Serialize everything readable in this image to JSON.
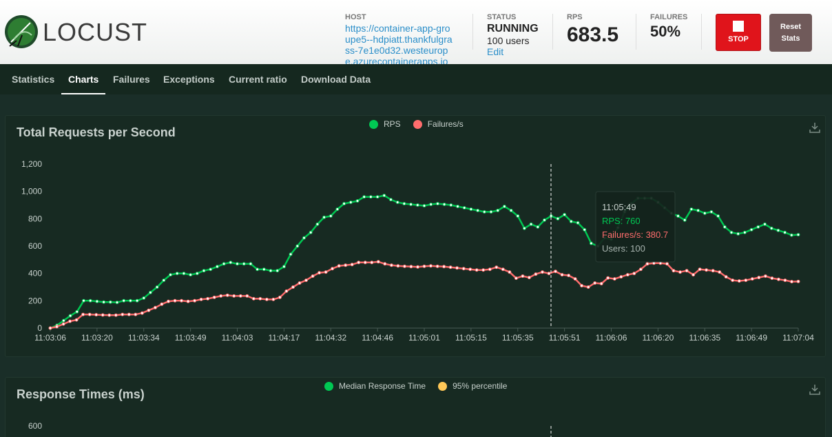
{
  "header": {
    "logo_text": "LOCUST",
    "host_label": "HOST",
    "host_url": "https://container-app-groupe5--hdpiatt.thankfulgrass-7e1e0d32.westeurope.azurecontainerapps.io",
    "status_label": "STATUS",
    "status_value": "RUNNING",
    "users_text": "100 users",
    "edit_label": "Edit",
    "rps_label": "RPS",
    "rps_value": "683.5",
    "failures_label": "FAILURES",
    "failures_value": "50%",
    "stop_label": "STOP",
    "reset_label_1": "Reset",
    "reset_label_2": "Stats"
  },
  "nav": {
    "tabs": [
      "Statistics",
      "Charts",
      "Failures",
      "Exceptions",
      "Current ratio",
      "Download Data"
    ],
    "active": "Charts"
  },
  "colors": {
    "rps": "#00c853",
    "failures": "#ff6d6d",
    "median": "#00c853",
    "p95": "#ffc857",
    "panel_bg": "#172a22"
  },
  "chart_data": [
    {
      "type": "line",
      "title": "Total Requests per Second",
      "ylim": [
        0,
        1200
      ],
      "yticks": [
        0,
        200,
        400,
        600,
        800,
        1000,
        1200
      ],
      "ytick_labels": [
        "0",
        "200",
        "400",
        "600",
        "800",
        "1,000",
        "1,200"
      ],
      "xtick_labels": [
        "11:03:06",
        "11:03:20",
        "11:03:34",
        "11:03:49",
        "11:04:03",
        "11:04:17",
        "11:04:32",
        "11:04:46",
        "11:05:01",
        "11:05:15",
        "11:05:35",
        "11:05:51",
        "11:06:06",
        "11:06:20",
        "11:06:35",
        "11:06:49",
        "11:07:04"
      ],
      "legend": "top-center",
      "series": [
        {
          "name": "RPS",
          "color_key": "rps",
          "values": [
            0,
            20,
            55,
            90,
            120,
            200,
            200,
            195,
            190,
            190,
            188,
            200,
            200,
            200,
            220,
            260,
            300,
            350,
            390,
            400,
            400,
            390,
            400,
            420,
            430,
            450,
            470,
            480,
            470,
            470,
            470,
            430,
            430,
            420,
            420,
            450,
            540,
            600,
            660,
            700,
            760,
            810,
            820,
            870,
            910,
            920,
            930,
            960,
            960,
            960,
            970,
            940,
            920,
            910,
            905,
            900,
            895,
            905,
            910,
            905,
            900,
            890,
            880,
            870,
            860,
            850,
            850,
            860,
            890,
            860,
            820,
            730,
            760,
            740,
            790,
            820,
            800,
            830,
            780,
            770,
            720,
            620,
            600,
            660,
            650,
            735,
            850,
            910,
            950,
            950,
            950,
            920,
            880,
            840,
            820,
            790,
            870,
            860,
            840,
            850,
            820,
            740,
            700,
            690,
            700,
            720,
            740,
            760,
            730,
            715,
            700,
            680,
            683
          ]
        },
        {
          "name": "Failures/s",
          "color_key": "failures",
          "values": [
            0,
            10,
            30,
            50,
            60,
            100,
            100,
            98,
            96,
            95,
            95,
            100,
            100,
            100,
            110,
            130,
            150,
            175,
            195,
            200,
            200,
            195,
            200,
            210,
            215,
            225,
            235,
            240,
            235,
            235,
            235,
            215,
            215,
            210,
            210,
            225,
            270,
            300,
            330,
            350,
            380,
            405,
            410,
            435,
            455,
            460,
            465,
            480,
            480,
            480,
            485,
            470,
            460,
            455,
            452,
            450,
            447,
            452,
            455,
            452,
            450,
            445,
            440,
            435,
            430,
            425,
            425,
            430,
            445,
            430,
            410,
            365,
            380,
            370,
            395,
            410,
            400,
            415,
            390,
            385,
            360,
            310,
            300,
            330,
            325,
            367,
            360,
            375,
            390,
            400,
            430,
            470,
            475,
            475,
            470,
            420,
            410,
            420,
            390,
            430,
            425,
            420,
            410,
            375,
            350,
            345,
            350,
            360,
            370,
            380,
            365,
            357,
            350,
            340,
            341
          ]
        }
      ],
      "tooltip": {
        "time": "11:05:49",
        "rps_text": "RPS: 760",
        "failures_text": "Failures/s: 380.7",
        "users_text": "Users: 100"
      }
    },
    {
      "type": "line",
      "title": "Response Times (ms)",
      "ylim": [
        0,
        600
      ],
      "ytick_labels": [
        "600"
      ],
      "legend": "top-center",
      "series": [
        {
          "name": "Median Response Time",
          "color_key": "median",
          "values": []
        },
        {
          "name": "95% percentile",
          "color_key": "p95",
          "values": []
        }
      ]
    }
  ]
}
